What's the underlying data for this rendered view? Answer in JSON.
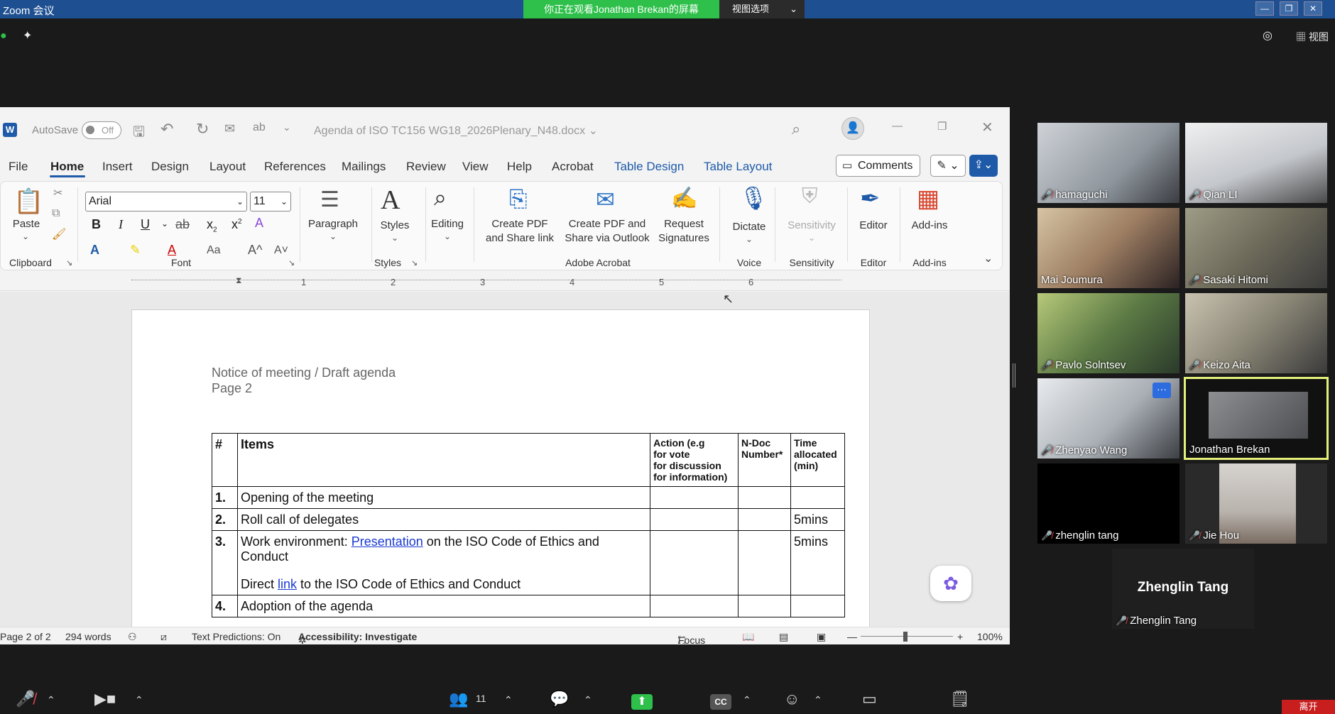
{
  "zoom": {
    "window_title": "Zoom 会议",
    "share_banner": "你正在观看Jonathan  Brekan的屏幕",
    "view_options": "视图选项",
    "view_button": "视图",
    "leave_button": "离开",
    "participants_count": "11"
  },
  "word": {
    "autosave_label": "AutoSave",
    "autosave_state": "Off",
    "doc_title": "Agenda of ISO TC156 WG18_2026Plenary_N48.docx",
    "menu": [
      "File",
      "Home",
      "Insert",
      "Design",
      "Layout",
      "References",
      "Mailings",
      "Review",
      "View",
      "Help",
      "Acrobat",
      "Table Design",
      "Table Layout"
    ],
    "comments_label": "Comments",
    "ribbon": {
      "paste": "Paste",
      "clipboard": "Clipboard",
      "font_name": "Arial",
      "font_size": "11",
      "font": "Font",
      "paragraph": "Paragraph",
      "styles": "Styles",
      "styles_group": "Styles",
      "editing": "Editing",
      "create_pdf_link_1": "Create PDF",
      "create_pdf_link_2": "and Share link",
      "create_pdf_outlook_1": "Create PDF and",
      "create_pdf_outlook_2": "Share via Outlook",
      "request_sig_1": "Request",
      "request_sig_2": "Signatures",
      "adobe_acrobat": "Adobe Acrobat",
      "dictate": "Dictate",
      "voice": "Voice",
      "sensitivity": "Sensitivity",
      "sensitivity_group": "Sensitivity",
      "editor": "Editor",
      "editor_group": "Editor",
      "addins": "Add-ins",
      "addins_group": "Add-ins"
    },
    "ruler_numbers": [
      "1",
      "2",
      "3",
      "4",
      "5",
      "6"
    ],
    "document": {
      "notice_line1": "Notice of meeting / Draft agenda",
      "notice_line2": "Page 2",
      "headers": {
        "num": "#",
        "items": "Items",
        "action": "Action (e.g for vote for discussion for information)",
        "action_lines": [
          "Action (e.g",
          "for vote",
          "for discussion",
          "for information)"
        ],
        "ndoc_lines": [
          "N-Doc",
          "Number*"
        ],
        "time_lines": [
          "Time",
          "allocated",
          "(min)"
        ]
      },
      "rows": [
        {
          "num": "1.",
          "item": "Opening of the meeting",
          "time": ""
        },
        {
          "num": "2.",
          "item": "Roll call of delegates",
          "time": "5mins"
        },
        {
          "num": "3.",
          "item_pre": "Work environment: ",
          "item_link": "Presentation",
          "item_post": " on the ISO Code of Ethics and Conduct",
          "item2_pre": "Direct ",
          "item2_link": "link",
          "item2_post": " to the ISO Code of Ethics and Conduct",
          "time": "5mins"
        },
        {
          "num": "4.",
          "item": "Adoption of the agenda",
          "time": ""
        }
      ]
    },
    "status": {
      "page": "Page 2 of 2",
      "words": "294 words",
      "text_predictions": "Text Predictions: On",
      "accessibility": "Accessibility: Investigate",
      "focus": "Focus",
      "zoom": "100%"
    }
  },
  "participants": [
    {
      "name": "hamaguchi",
      "muted": true
    },
    {
      "name": "Qian LI",
      "muted": true
    },
    {
      "name": "Mai Joumura",
      "muted": false
    },
    {
      "name": "Sasaki Hitomi",
      "muted": true
    },
    {
      "name": "Pavlo Solntsev",
      "muted": true
    },
    {
      "name": "Keizo Aita",
      "muted": true
    },
    {
      "name": "Zhenyao Wang",
      "muted": true
    },
    {
      "name": "Jonathan Brekan",
      "muted": false
    },
    {
      "name": "zhenglin tang",
      "muted": true
    },
    {
      "name": "Jie Hou",
      "muted": true
    }
  ],
  "self_tile": {
    "display": "Zhenglin Tang",
    "name": "Zhenglin Tang"
  },
  "colors": {
    "zoom_green": "#2ec04a",
    "word_blue": "#1e5aa8",
    "active_speaker": "#e3f07a",
    "mute_red": "#e5484d"
  }
}
